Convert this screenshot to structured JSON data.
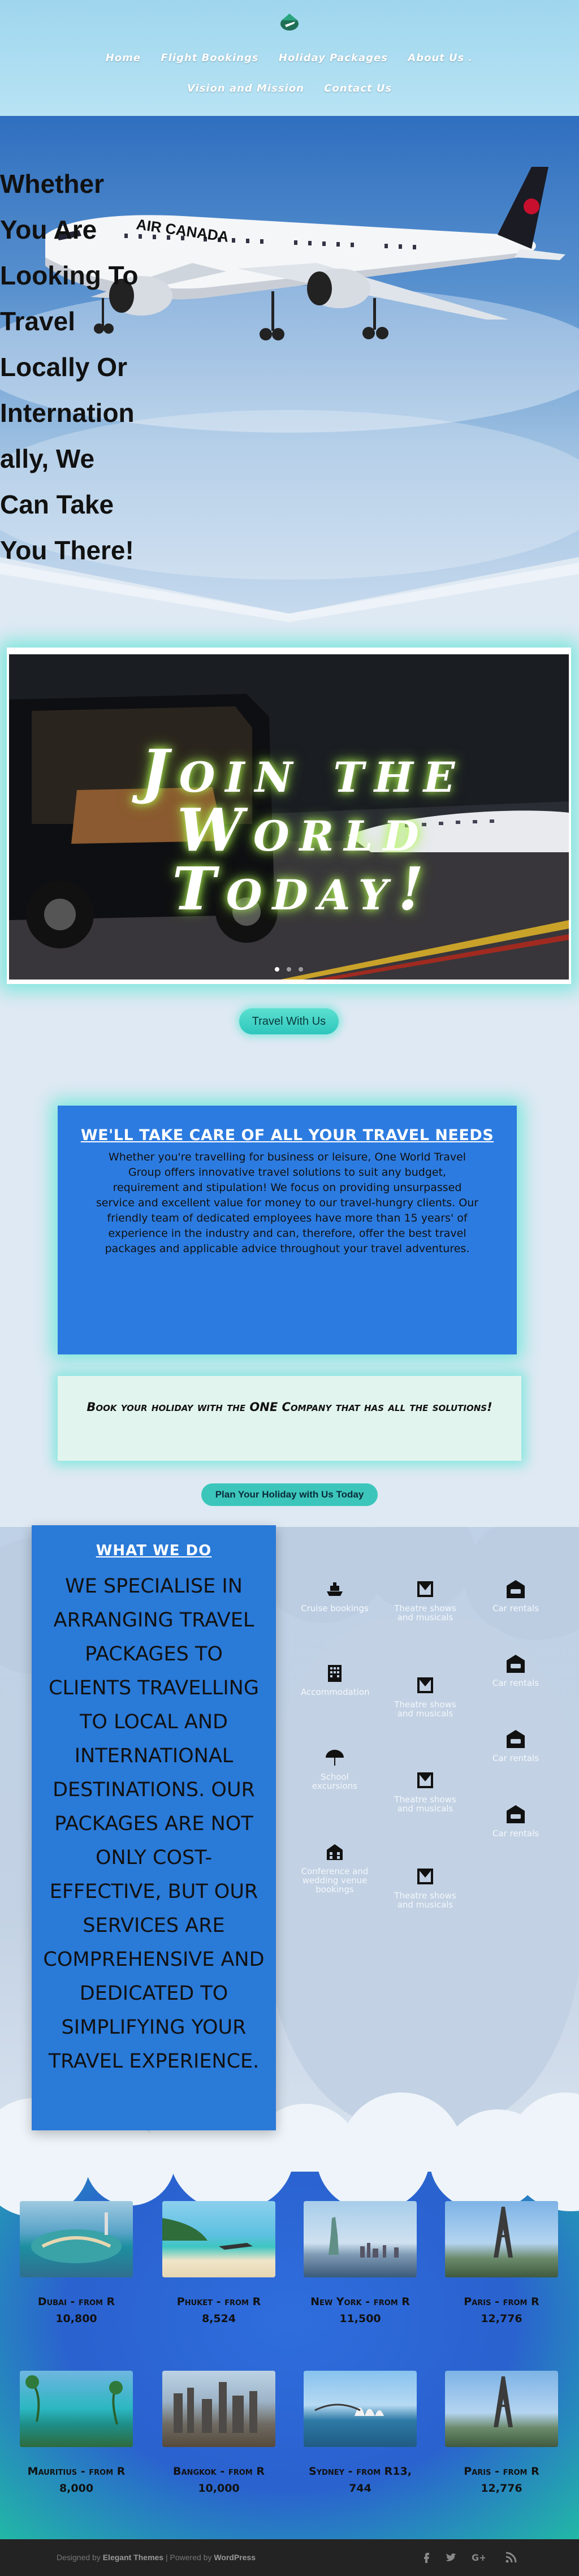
{
  "header": {
    "nav_row1": [
      "Home",
      "Flight Bookings",
      "Holiday Packages",
      "About Us"
    ],
    "nav_row2": [
      "Vision and Mission",
      "Contact Us"
    ]
  },
  "hero": {
    "headline": "Whether You Are Looking To Travel Locally Or Internationally, We Can Take You There!"
  },
  "slider": {
    "title_line1": "Join the",
    "title_line2": "World",
    "title_line3": "Today!",
    "dot_count": 3,
    "active_dot": 1
  },
  "travel_button": "Travel With Us",
  "care": {
    "title": "WE'LL TAKE CARE OF ALL YOUR TRAVEL NEEDS",
    "body": "Whether you're travelling for business or leisure, One World Travel Group offers innovative travel solutions to suit any budget, requirement and stipulation! We focus on providing unsurpassed service and excellent value for money to our travel-hungry clients. Our friendly team of dedicated employees have more than 15 years' of experience in the industry and can, therefore, offer the best travel packages and applicable advice throughout your travel adventures."
  },
  "book": {
    "text": "Book your holiday with the ONE Company that has all the solutions!"
  },
  "plan_button": "Plan Your Holiday with Us Today",
  "what_we_do": {
    "title": "WHAT WE DO",
    "body": "We specialise in arranging travel packages to clients travelling to local and international destinations. Our packages are not only cost-effective, but our services are comprehensive and dedicated to simplifying your travel experience."
  },
  "services": {
    "col1": [
      {
        "label": "Cruise bookings",
        "icon": "ship-icon"
      },
      {
        "label": "Accommodation",
        "icon": "building-icon"
      },
      {
        "label": "School excursions",
        "icon": "umbrella-icon"
      },
      {
        "label": "Conference and wedding venue bookings",
        "icon": "venue-icon"
      }
    ],
    "col2": [
      {
        "label": "Theatre shows and musicals",
        "icon": "theatre-icon"
      },
      {
        "label": "Theatre shows and musicals",
        "icon": "theatre-icon"
      },
      {
        "label": "Theatre shows and musicals",
        "icon": "theatre-icon"
      },
      {
        "label": "Theatre shows and musicals",
        "icon": "theatre-icon"
      }
    ],
    "col3": [
      {
        "label": "Car rentals",
        "icon": "car-icon"
      },
      {
        "label": "Car rentals",
        "icon": "car-icon"
      },
      {
        "label": "Car rentals",
        "icon": "car-icon"
      },
      {
        "label": "Car rentals",
        "icon": "car-icon"
      }
    ]
  },
  "destinations": [
    {
      "caption": "Dubai - from R 10,800"
    },
    {
      "caption": "Phuket - from R 8,524"
    },
    {
      "caption": "New York - from R 11,500"
    },
    {
      "caption": "Paris - from R 12,776"
    },
    {
      "caption": "Mauritius - from R 8,000"
    },
    {
      "caption": "Bangkok - from R 10,000"
    },
    {
      "caption": "Sydney - from R13, 744"
    },
    {
      "caption": "Paris - from R 12,776"
    }
  ],
  "footer": {
    "designed_by_prefix": "Designed by",
    "designed_by": "Elegant Themes",
    "powered_by_prefix": "| Powered by",
    "powered_by": "WordPress"
  },
  "colors": {
    "accent_teal": "#3cc6bb",
    "box_blue": "#2c7be0",
    "footer_bg": "#232323"
  }
}
